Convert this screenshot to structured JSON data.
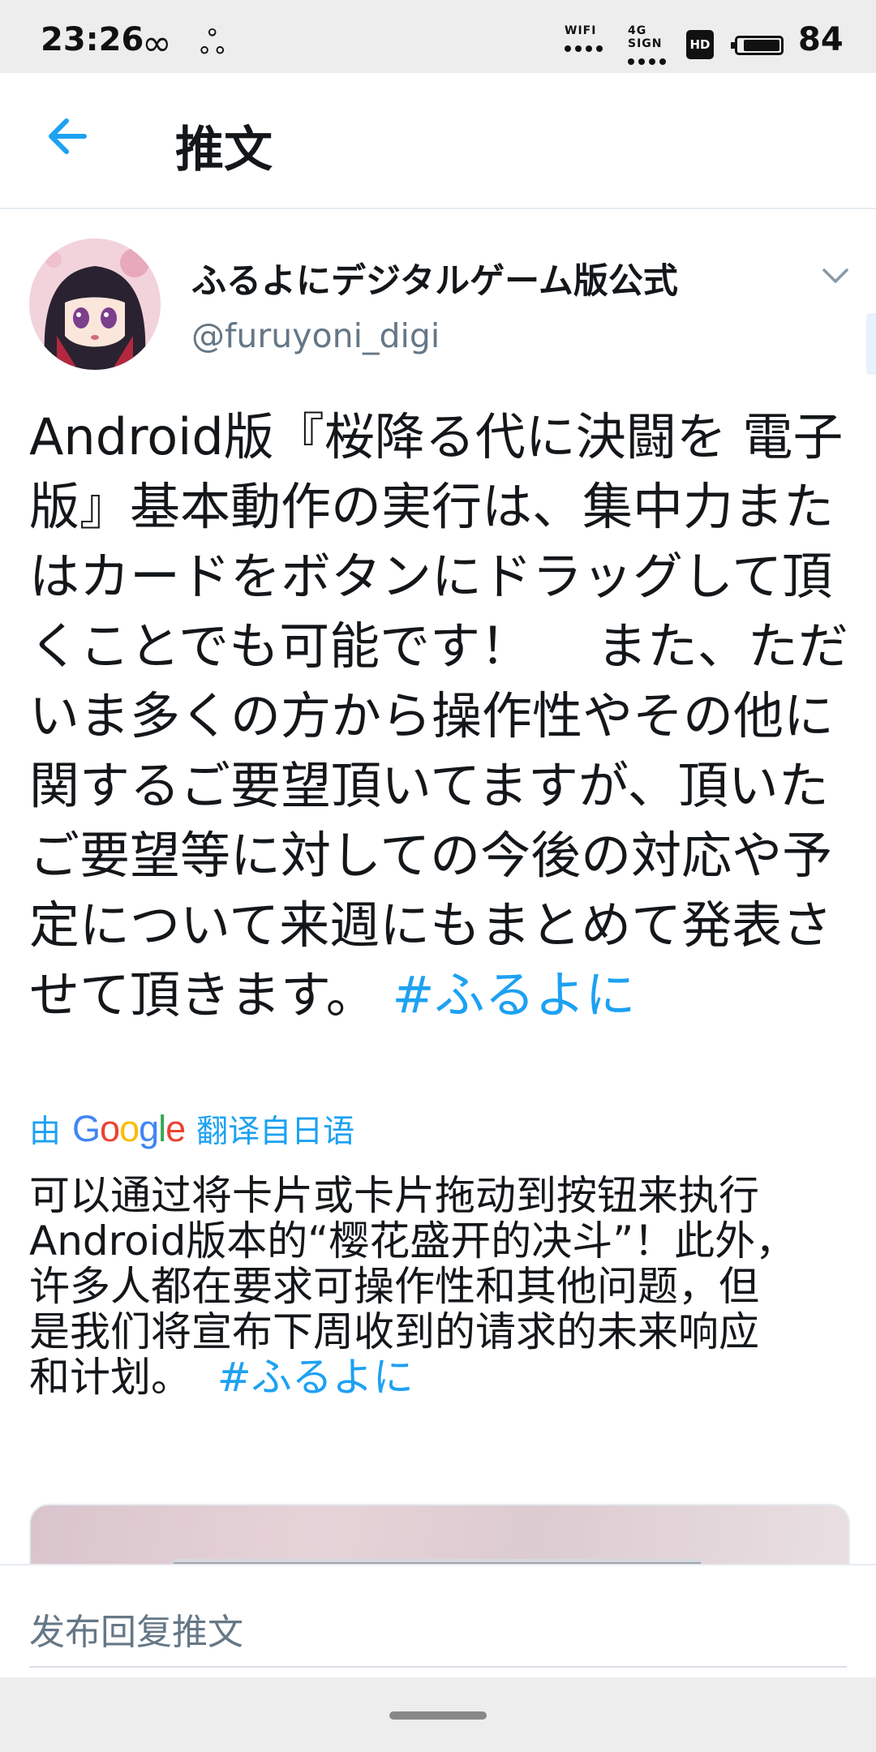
{
  "status_bar": {
    "time": "23:26",
    "infinity_glyph": "∞",
    "app_glyph": "ஃ",
    "wifi_label": "WIFI",
    "signal_label": "4G SIGN",
    "hd_label": "HD",
    "battery": "84"
  },
  "app_bar": {
    "title": "推文",
    "back_icon": "arrow-left-icon",
    "accent_color": "#1da1f2"
  },
  "tweet": {
    "author": {
      "display_name": "ふるよにデジタルゲーム版公式",
      "handle": "@furuyoni_digi"
    },
    "text": "Android版『桜降る代に決闘を 電子版』基本動作の実行は、集中力またはカードをボタンにドラッグして頂くことでも可能です！　 また、ただいま多くの方から操作性やその他に関するご要望頂いてますが、頂いたご要望等に対しての今後の対応や予定について来週にもまとめて発表させて頂きます。",
    "hashtag": "#ふるよに",
    "translated_by": {
      "prefix": "由",
      "brand": "Google",
      "suffix": "翻译自日语"
    },
    "translation_lines": [
      "可以通过将卡片或卡片拖动到按钮来执行",
      "Android版本的“樱花盛开的决斗”！此外，",
      "许多人都在要求可操作性和其他问题，但",
      "是我们将宣布下周收到的请求的未来响应"
    ],
    "translation_last_line": "和计划。",
    "translation_hashtag": "#ふるよに"
  },
  "reply": {
    "placeholder": "发布回复推文"
  }
}
